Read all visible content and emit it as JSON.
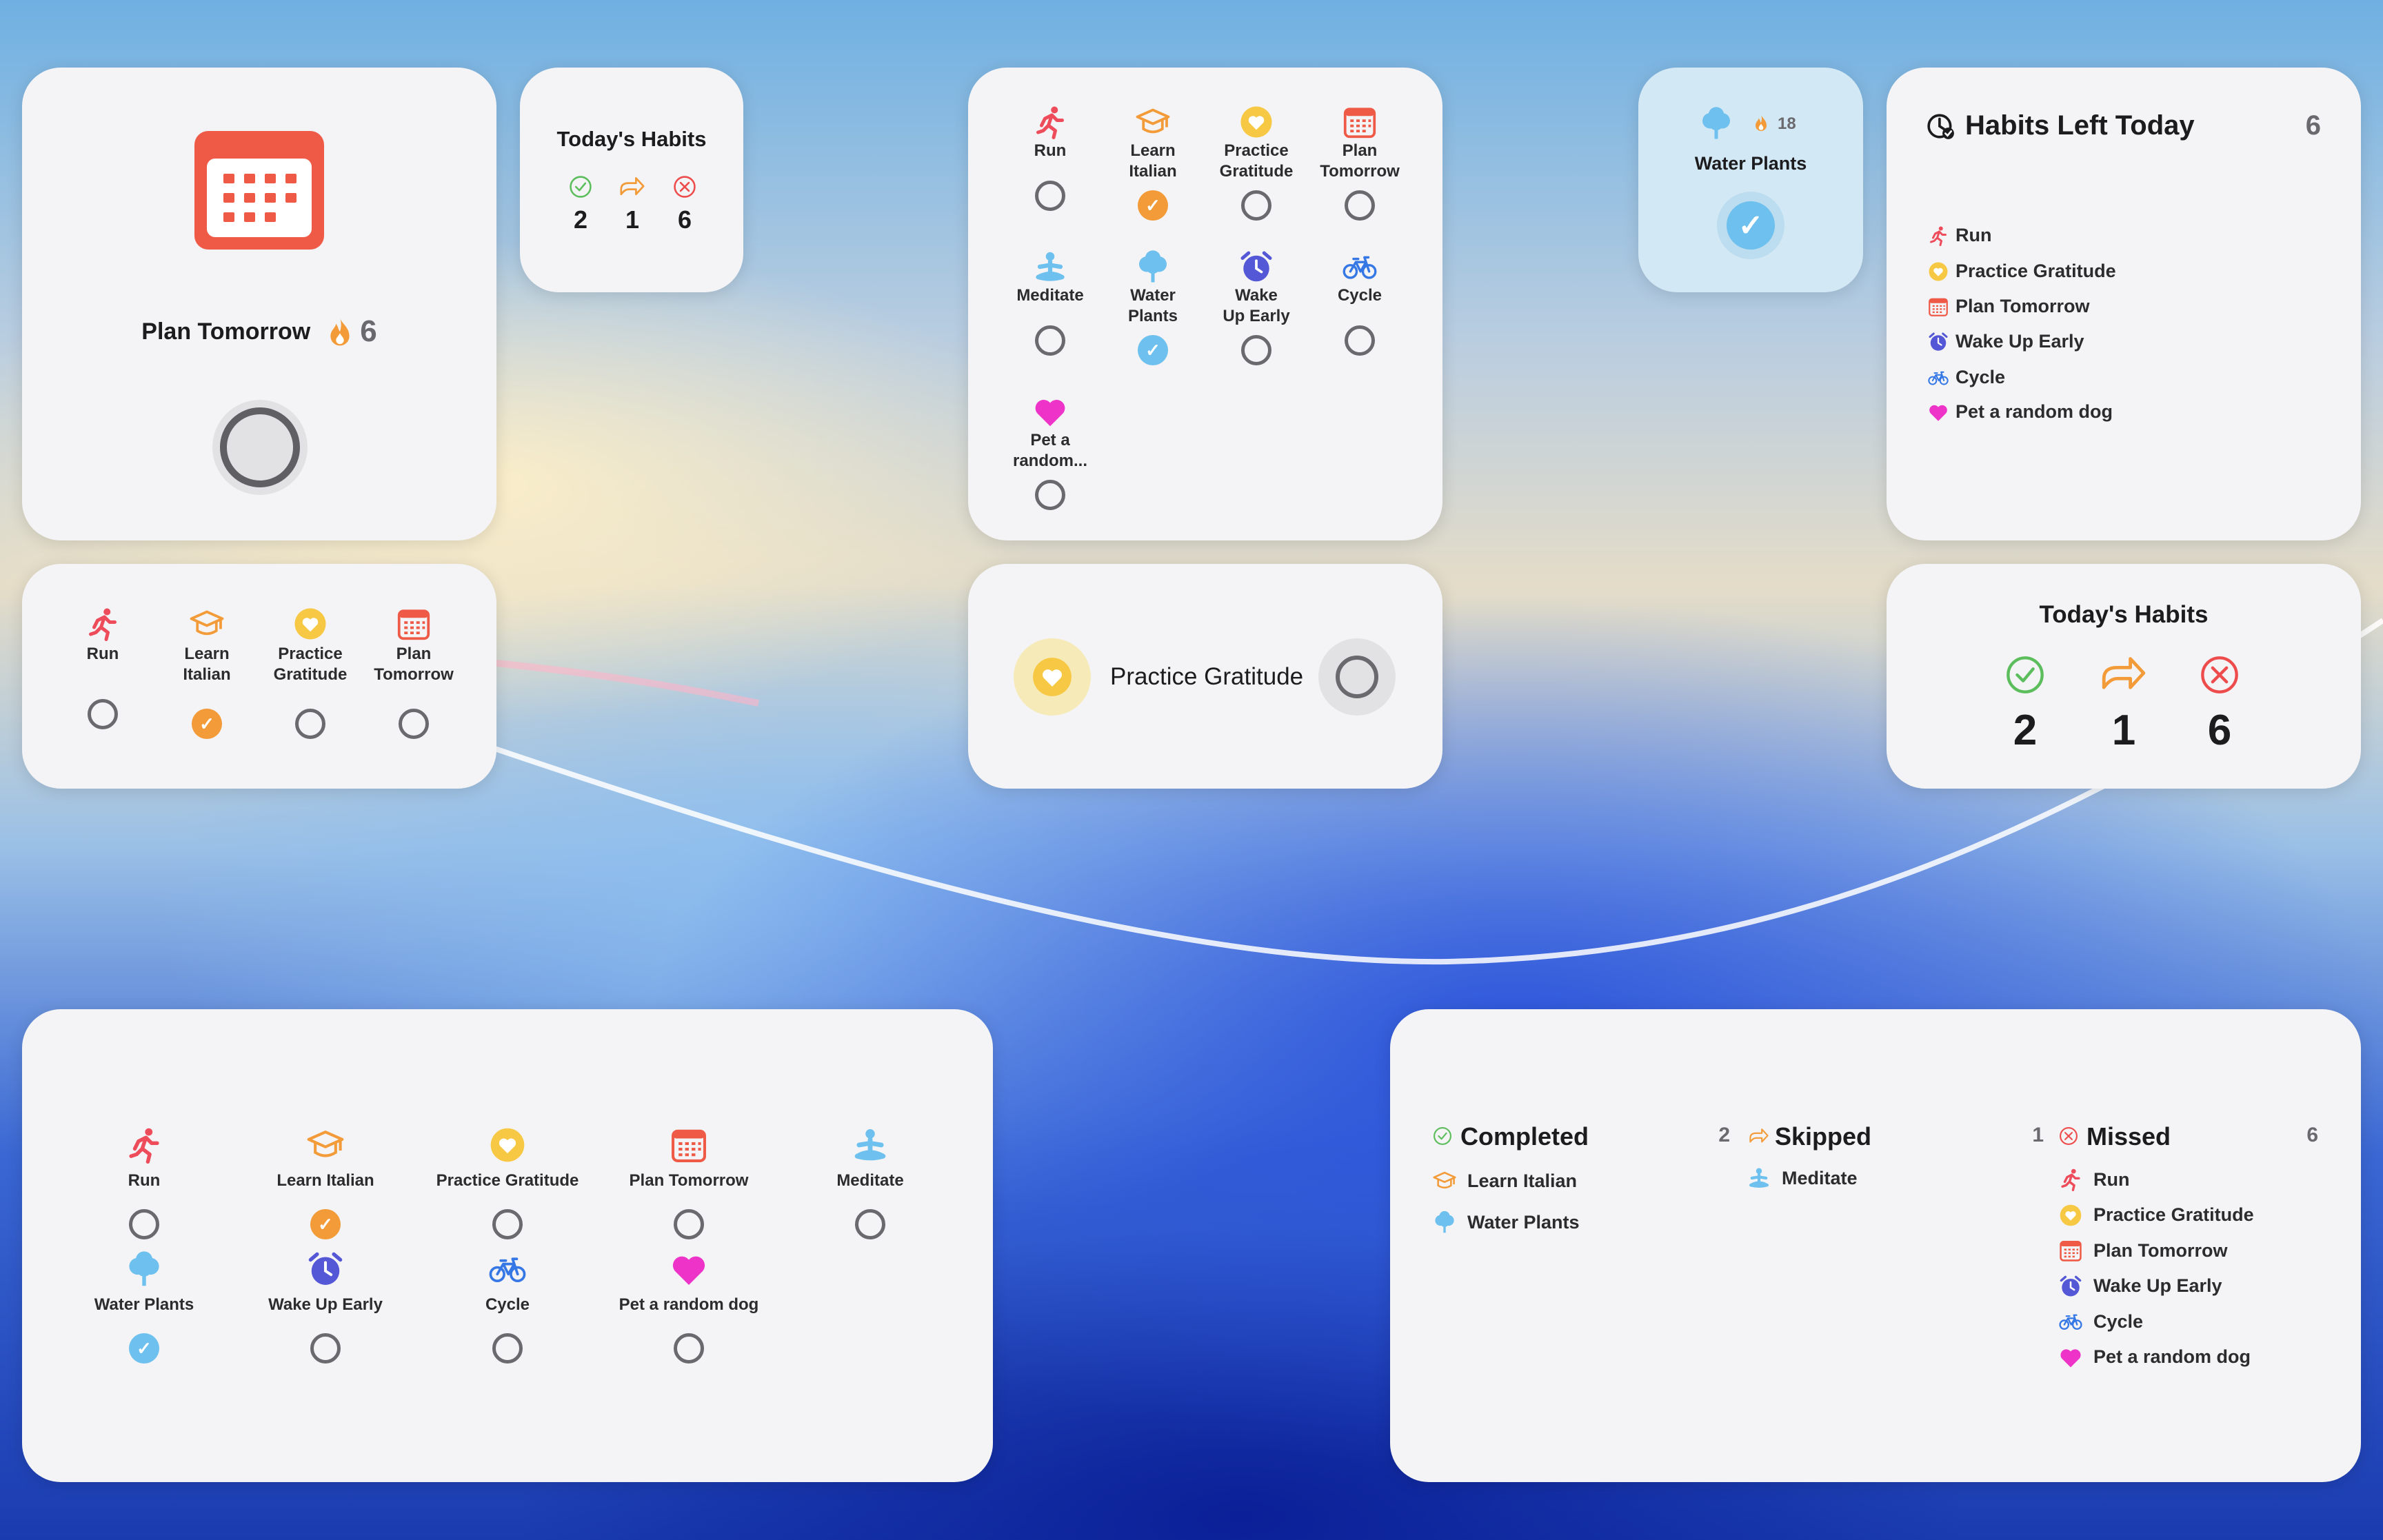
{
  "colors": {
    "accent_red": "#ee5a46",
    "accent_orange": "#f29b38",
    "accent_yellow": "#f7c843",
    "accent_blue": "#6ec0ee",
    "accent_indigo": "#5458d6",
    "accent_pink": "#ee33c9",
    "accent_green": "#5bbd5b"
  },
  "single_habit": {
    "icon": "calendar-icon",
    "name": "Plan Tomorrow",
    "streak": "6",
    "streak_icon": "flame-icon"
  },
  "today_small": {
    "title": "Today's Habits",
    "completed": "2",
    "skipped": "1",
    "missed": "6"
  },
  "grid_medium": {
    "items": [
      {
        "label_1": "Run",
        "label_2": "",
        "icon": "running-person-icon",
        "done": false
      },
      {
        "label_1": "Learn",
        "label_2": "Italian",
        "icon": "graduation-cap-icon",
        "done": true
      },
      {
        "label_1": "Practice",
        "label_2": "Gratitude",
        "icon": "heart-circle-icon",
        "done": false
      },
      {
        "label_1": "Plan",
        "label_2": "Tomorrow",
        "icon": "calendar-icon",
        "done": false
      },
      {
        "label_1": "Meditate",
        "label_2": "",
        "icon": "meditate-icon",
        "done": false
      },
      {
        "label_1": "Water",
        "label_2": "Plants",
        "icon": "tree-icon",
        "done": true
      },
      {
        "label_1": "Wake",
        "label_2": "Up Early",
        "icon": "alarm-icon",
        "done": false
      },
      {
        "label_1": "Cycle",
        "label_2": "",
        "icon": "bicycle-icon",
        "done": false
      },
      {
        "label_1": "Pet a",
        "label_2": "random...",
        "icon": "heart-icon",
        "done": false
      }
    ]
  },
  "water_widget": {
    "icon": "tree-icon",
    "streak": "18",
    "name": "Water Plants"
  },
  "habits_left": {
    "title": "Habits Left Today",
    "count": "6",
    "items": [
      {
        "label": "Run",
        "icon": "running-person-icon"
      },
      {
        "label": "Practice Gratitude",
        "icon": "heart-circle-icon"
      },
      {
        "label": "Plan Tomorrow",
        "icon": "calendar-icon"
      },
      {
        "label": "Wake Up Early",
        "icon": "alarm-icon"
      },
      {
        "label": "Cycle",
        "icon": "bicycle-icon"
      },
      {
        "label": "Pet a random dog",
        "icon": "heart-icon"
      }
    ]
  },
  "row_four": {
    "items": [
      {
        "label_1": "Run",
        "label_2": "",
        "done": false
      },
      {
        "label_1": "Learn",
        "label_2": "Italian",
        "done": true
      },
      {
        "label_1": "Practice",
        "label_2": "Gratitude",
        "done": false
      },
      {
        "label_1": "Plan",
        "label_2": "Tomorrow",
        "done": false
      }
    ]
  },
  "gratitude_widget": {
    "name": "Practice Gratitude"
  },
  "today_medium": {
    "title": "Today's Habits",
    "completed": "2",
    "skipped": "1",
    "missed": "6"
  },
  "large_grid": {
    "items": [
      {
        "label": "Run",
        "done": false
      },
      {
        "label": "Learn Italian",
        "done": true
      },
      {
        "label": "Practice Gratitude",
        "done": false
      },
      {
        "label": "Plan Tomorrow",
        "done": false
      },
      {
        "label": "Meditate",
        "done": false
      },
      {
        "label": "Water Plants",
        "done": true
      },
      {
        "label": "Wake Up Early",
        "done": false
      },
      {
        "label": "Cycle",
        "done": false
      },
      {
        "label": "Pet a random dog",
        "done": false
      }
    ]
  },
  "summary": {
    "completed": {
      "title": "Completed",
      "count": "2",
      "items": [
        "Learn Italian",
        "Water Plants"
      ]
    },
    "skipped": {
      "title": "Skipped",
      "count": "1",
      "items": [
        "Meditate"
      ]
    },
    "missed": {
      "title": "Missed",
      "count": "6",
      "items": [
        "Run",
        "Practice Gratitude",
        "Plan Tomorrow",
        "Wake Up Early",
        "Cycle",
        "Pet a random dog"
      ]
    }
  }
}
